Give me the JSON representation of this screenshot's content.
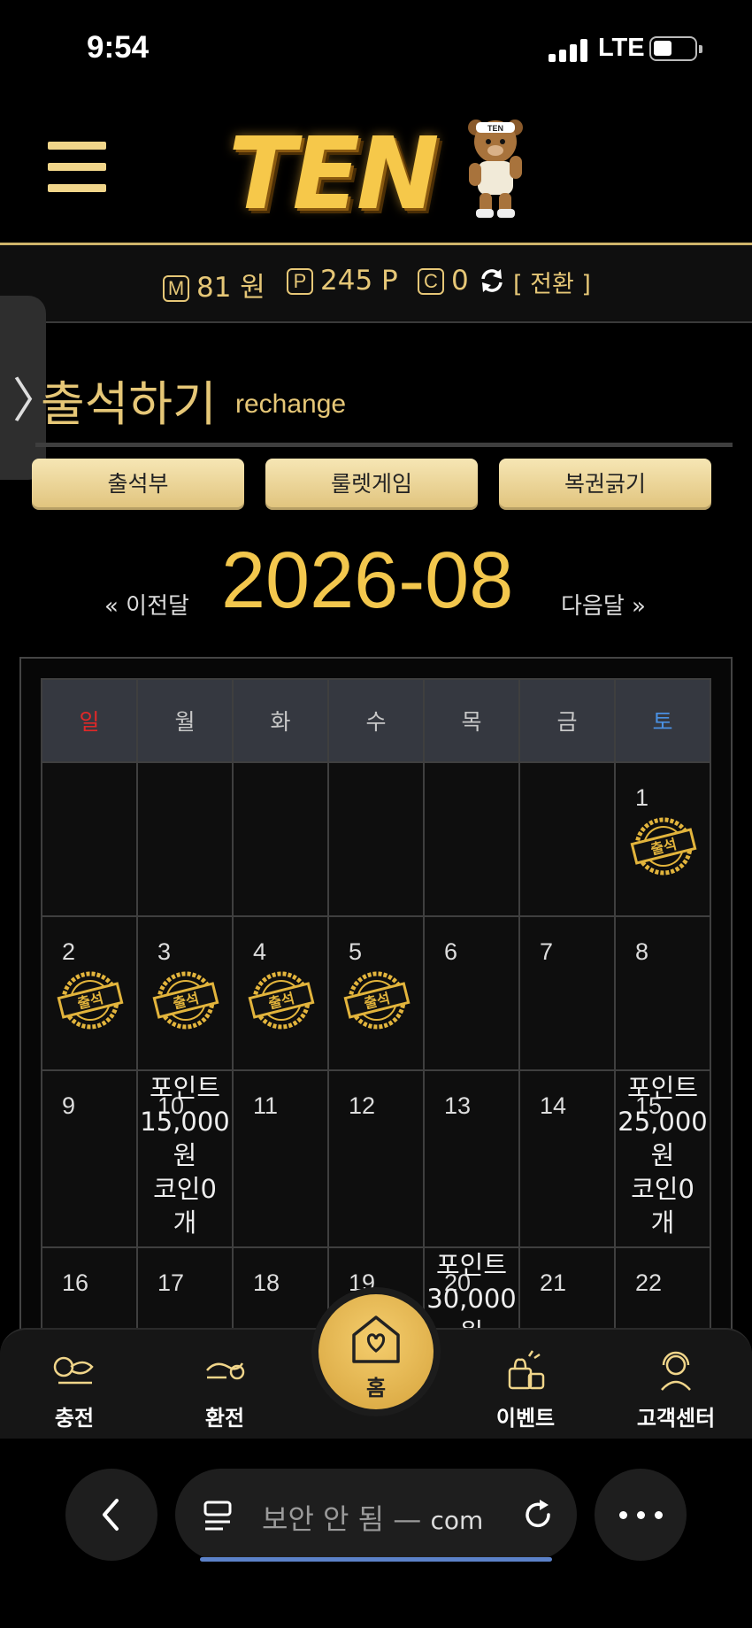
{
  "status_bar": {
    "time": "9:54",
    "network": "LTE"
  },
  "header": {
    "logo_text": "TEN",
    "logo_badge": "TEN"
  },
  "wallet": {
    "money_badge": "M",
    "money_value": "81 원",
    "point_badge": "P",
    "point_value": "245 P",
    "coin_badge": "C",
    "coin_value": "0",
    "convert_label": "[ 전환 ]"
  },
  "side_tab": {
    "arrow": "〉"
  },
  "page": {
    "title": "출석하기",
    "subtitle": "rechange"
  },
  "tabs": [
    "출석부",
    "룰렛게임",
    "복권긁기"
  ],
  "month_nav": {
    "prev": "« 이전달",
    "current": "2026-08",
    "next": "다음달 »"
  },
  "calendar": {
    "weekdays": [
      "일",
      "월",
      "화",
      "수",
      "목",
      "금",
      "토"
    ],
    "stamp_label": "출석",
    "week1": {
      "sat": "1"
    },
    "week2": [
      "2",
      "3",
      "4",
      "5",
      "6",
      "7",
      "8"
    ],
    "week3": [
      "9",
      "10",
      "11",
      "12",
      "13",
      "14",
      "15"
    ],
    "week4": [
      "16",
      "17",
      "18",
      "19",
      "20",
      "21",
      "22"
    ],
    "reward_10": {
      "line1": "포인트",
      "line2": "15,000",
      "line3": "원",
      "line4": "코인0",
      "line5": "개"
    },
    "reward_15": {
      "line1": "포인트",
      "line2": "25,000",
      "line3": "원",
      "line4": "코인0",
      "line5": "개"
    },
    "reward_20": {
      "line1": "포인트",
      "line2": "30,000",
      "line3": "원"
    }
  },
  "bottom_nav": {
    "charge": "충전",
    "exchange": "환전",
    "home": "홈",
    "event": "이벤트",
    "support": "고객센터"
  },
  "browser": {
    "url_text": "보안 안 됨 —",
    "url_domain": "com"
  },
  "colors": {
    "gold": "#e6c777",
    "sunday": "#e02828",
    "saturday": "#4a90e2",
    "background": "#000000"
  }
}
